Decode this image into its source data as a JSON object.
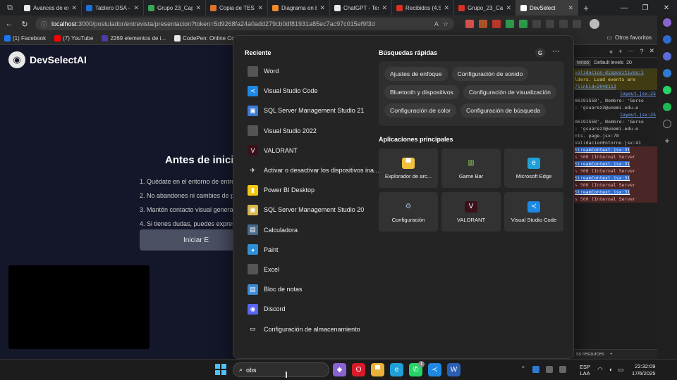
{
  "browser": {
    "tabs": [
      {
        "label": "Avances de en",
        "color": "#e8e8e8",
        "active": false
      },
      {
        "label": "Tablero DSA -",
        "color": "#1f6fd6",
        "active": false
      },
      {
        "label": "Grupo 23_Cap",
        "color": "#35a853",
        "active": false
      },
      {
        "label": "Copia de TESIS",
        "color": "#e0722c",
        "active": false
      },
      {
        "label": "Diagrama en b",
        "color": "#f08a2c",
        "active": false
      },
      {
        "label": "ChatGPT - Tesi",
        "color": "#e8e8e8",
        "active": false
      },
      {
        "label": "Recibidos (4.5",
        "color": "#d93025",
        "active": false
      },
      {
        "label": "Grupo_23_Cap",
        "color": "#d93025",
        "active": false
      },
      {
        "label": "DevSelect",
        "color": "#ffffff",
        "active": true
      }
    ],
    "address": {
      "host": "localhost",
      "rest": ":3000/postulador/entrevista/presentacion?token=5d9268fa24a0add279cb0df81931a85ec7ac97c015ef9f3d"
    },
    "bookmarks": [
      {
        "label": "(1) Facebook",
        "color": "#1877f2"
      },
      {
        "label": "(7) YouTube",
        "color": "#ff0000"
      },
      {
        "label": "2269 elementos de i...",
        "color": "#4b3aa8"
      },
      {
        "label": "CodePen: Online Co...",
        "color": "#e8e8e8"
      }
    ],
    "bookmarks_other": "Otros favoritos"
  },
  "page": {
    "brand": "DevSelectAI",
    "heading": "Antes de inici",
    "instructions": [
      "1. Quédate en el entorno de entre",
      "2. No abandones ni cambies de pe",
      "3. Mantén contacto visual general",
      "4. Si tienes dudas, puedes expresa"
    ],
    "start_button": "Iniciar E"
  },
  "devtools": {
    "filter_chip": "tenso",
    "levels": "Default levels",
    "issues": "20",
    "logs": [
      {
        "kind": "warn",
        "text": "validacion-dispositivos:1",
        "link": true
      },
      {
        "kind": "warn",
        "text": "lders. Load events are",
        "link": false
      },
      {
        "kind": "warn",
        "text": "71inkid=2048113",
        "link": true
      },
      {
        "kind": "plain",
        "text": "layout.jsx:25",
        "link": true
      },
      {
        "kind": "plain",
        "text": "06191558', Nombre: 'Gerso",
        "link": false
      },
      {
        "kind": "plain",
        "text": ": 'gsuarez3@unemi.edu.e",
        "link": false
      },
      {
        "kind": "plain",
        "text": "layout.jsx:25",
        "link": true
      },
      {
        "kind": "plain",
        "text": "06191558', Nombre: 'Gerso",
        "link": false
      },
      {
        "kind": "plain",
        "text": ": 'gsuarez3@unemi.edu.e",
        "link": false
      },
      {
        "kind": "plain",
        "text": "nts.  page.jsx:78",
        "link": false
      },
      {
        "kind": "plain",
        "text": "ValidacionEntorno.jsx:41",
        "link": false
      },
      {
        "kind": "err",
        "text": "StreamContext.jsx:31",
        "link": true
      },
      {
        "kind": "err",
        "text": "s 500 (Internal Server",
        "link": false
      },
      {
        "kind": "err",
        "text": "StreamContext.jsx:31",
        "link": true
      },
      {
        "kind": "err",
        "text": "s 500 (Internal Server",
        "link": false
      },
      {
        "kind": "err",
        "text": "StreamContext.jsx:31",
        "link": true
      },
      {
        "kind": "err",
        "text": "s 500 (Internal Server",
        "link": false
      },
      {
        "kind": "err",
        "text": "StreamContext.jsx:31",
        "link": true
      },
      {
        "kind": "err",
        "text": "s 500 (Internal Server",
        "link": false
      }
    ],
    "bottom": "ss resources"
  },
  "start_menu": {
    "recent_title": "Reciente",
    "recent": [
      {
        "label": "Word",
        "icon": "word-icon",
        "color": "#555555",
        "glyph": ""
      },
      {
        "label": "Visual Studio Code",
        "icon": "vscode-icon",
        "color": "#1e88e5",
        "glyph": "≺"
      },
      {
        "label": "SQL Server Management Studio 21",
        "icon": "ssms-icon",
        "color": "#3a7bd5",
        "glyph": "▣"
      },
      {
        "label": "Visual Studio 2022",
        "icon": "visual-studio-icon",
        "color": "#555555",
        "glyph": ""
      },
      {
        "label": "VALORANT",
        "icon": "valorant-icon",
        "color": "#3b1018",
        "glyph": "V"
      },
      {
        "label": "Activar o desactivar los dispositivos ina...",
        "icon": "airplane-icon",
        "color": "transparent",
        "glyph": "✈"
      },
      {
        "label": "Power BI Desktop",
        "icon": "powerbi-icon",
        "color": "#f2c811",
        "glyph": "▮"
      },
      {
        "label": "SQL Server Management Studio 20",
        "icon": "ssms-icon",
        "color": "#d9b64a",
        "glyph": "▣"
      },
      {
        "label": "Calculadora",
        "icon": "calculator-icon",
        "color": "#4a6a8a",
        "glyph": "▤"
      },
      {
        "label": "Paint",
        "icon": "paint-icon",
        "color": "#2f8fd8",
        "glyph": "◕"
      },
      {
        "label": "Excel",
        "icon": "excel-icon",
        "color": "#555555",
        "glyph": ""
      },
      {
        "label": "Bloc de notas",
        "icon": "notepad-icon",
        "color": "#3a8ad6",
        "glyph": "▤"
      },
      {
        "label": "Discord",
        "icon": "discord-icon",
        "color": "#5865f2",
        "glyph": "◉"
      },
      {
        "label": "Configuración de almacenamiento",
        "icon": "storage-icon",
        "color": "transparent",
        "glyph": "▭"
      }
    ],
    "quick_title": "Búsquedas rápidas",
    "quick_avatar": "G",
    "quick": [
      "Ajustes de enfoque",
      "Configuración de sonido",
      "Bluetooth y dispositivos",
      "Configuración de visualización",
      "Configuración de color",
      "Configuración de búsqueda"
    ],
    "apps_title": "Aplicaciones principales",
    "apps": [
      {
        "label": "Explorador de arc...",
        "icon": "folder-icon",
        "color": "#f3c03d",
        "glyph": "▀"
      },
      {
        "label": "Game Bar",
        "icon": "game-bar-icon",
        "color": "transparent",
        "glyph": "▥"
      },
      {
        "label": "Microsoft Edge",
        "icon": "edge-icon",
        "color": "#1fa0d8",
        "glyph": "e"
      },
      {
        "label": "Configuración",
        "icon": "settings-icon",
        "color": "transparent",
        "glyph": "⚙"
      },
      {
        "label": "VALORANT",
        "icon": "valorant-icon",
        "color": "#3b1018",
        "glyph": "V"
      },
      {
        "label": "Visual Studio Code",
        "icon": "vscode-icon",
        "color": "#1e88e5",
        "glyph": "≺"
      }
    ]
  },
  "taskbar": {
    "search_text": "obs",
    "apps": [
      {
        "name": "copilot-icon",
        "color": "#8a63d2",
        "glyph": "◆"
      },
      {
        "name": "opera-icon",
        "color": "#d91a2a",
        "glyph": "O"
      },
      {
        "name": "file-explorer-icon",
        "color": "#e8b23a",
        "glyph": "▀"
      },
      {
        "name": "edge-icon",
        "color": "#1fa0d8",
        "glyph": "e"
      },
      {
        "name": "whatsapp-icon",
        "color": "#25d366",
        "glyph": "✆"
      },
      {
        "name": "vscode-icon",
        "color": "#1e88e5",
        "glyph": "≺"
      },
      {
        "name": "word-icon",
        "color": "#2b5fb4",
        "glyph": "W"
      }
    ],
    "whatsapp_badge": "1",
    "lang_line1": "ESP",
    "lang_line2": "LAA",
    "time": "22:32:09",
    "date": "17/6/2025"
  }
}
